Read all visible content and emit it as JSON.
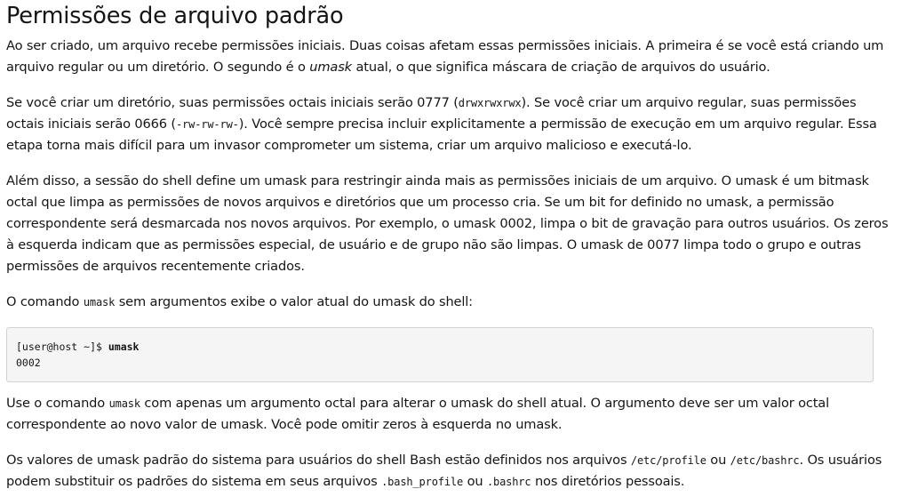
{
  "title": "Permissões de arquivo padrão",
  "p1": {
    "a": "Ao ser criado, um arquivo recebe permissões iniciais. Duas coisas afetam essas permissões iniciais. A primeira é se você está criando um arquivo regular ou um diretório. O segundo é o ",
    "em": "umask",
    "b": " atual, o que significa máscara de criação de arquivos do usuário."
  },
  "p2": {
    "a": "Se você criar um diretório, suas permissões octais iniciais serão 0777 (",
    "code1": "drwxrwxrwx",
    "b": "). Se você criar um arquivo regular, suas permissões octais iniciais serão 0666 (",
    "code2": "-rw-rw-rw-",
    "c": "). Você sempre precisa incluir explicitamente a permissão de execução em um arquivo regular. Essa etapa torna mais difícil para um invasor comprometer um sistema, criar um arquivo malicioso e executá-lo."
  },
  "p3": "Além disso, a sessão do shell define um umask para restringir ainda mais as permissões iniciais de um arquivo. O umask é um bitmask octal que limpa as permissões de novos arquivos e diretórios que um processo cria. Se um bit for definido no umask, a permissão correspondente será desmarcada nos novos arquivos. Por exemplo, o umask 0002, limpa o bit de gravação para outros usuários. Os zeros à esquerda indicam que as permissões especial, de usuário e de grupo não são limpas. O umask de 0077 limpa todo o grupo e outras permissões de arquivos recentemente criados.",
  "p4": {
    "a": "O comando ",
    "code": "umask",
    "b": " sem argumentos exibe o valor atual do umask do shell:"
  },
  "code_block": {
    "prompt": "[user@host ~]$ ",
    "command": "umask",
    "output": "0002"
  },
  "p5": {
    "a": "Use o comando ",
    "code": "umask",
    "b": " com apenas um argumento octal para alterar o umask do shell atual. O argumento deve ser um valor octal correspondente ao novo valor de umask. Você pode omitir zeros à esquerda no umask."
  },
  "p6": {
    "a": "Os valores de umask padrão do sistema para usuários do shell Bash estão definidos nos arquivos ",
    "code1": "/etc/profile",
    "b": " ou ",
    "code2": "/etc/bashrc",
    "c": ". Os usuários podem substituir os padrões do sistema em seus arquivos ",
    "code3": ".bash_profile",
    "d": " ou ",
    "code4": ".bashrc",
    "e": " nos diretórios pessoais."
  }
}
